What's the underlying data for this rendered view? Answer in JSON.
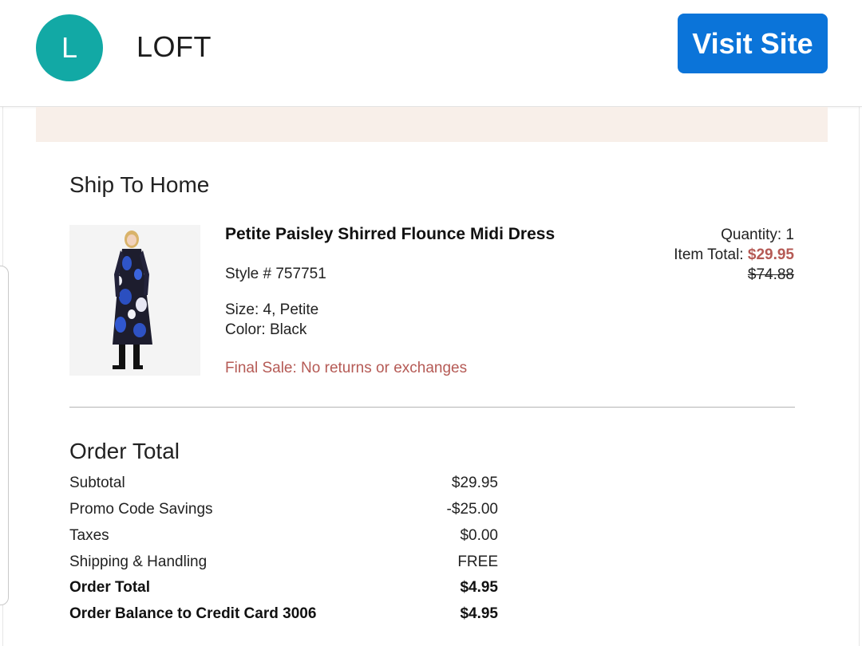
{
  "header": {
    "avatar_letter": "L",
    "brand_name": "LOFT",
    "visit_button_label": "Visit Site"
  },
  "colors": {
    "avatar_bg": "#12a9a5",
    "visit_button_bg": "#0b74d9",
    "banner_bg": "#f8efe9",
    "sale_red": "#b55a55"
  },
  "ship_section": {
    "title": "Ship To Home"
  },
  "product": {
    "image_icon": "product-photo",
    "name": "Petite Paisley Shirred Flounce Midi Dress",
    "style": "Style # 757751",
    "size": "Size: 4, Petite",
    "color": "Color: Black",
    "final_sale": "Final Sale: No returns or exchanges",
    "quantity": "Quantity: 1",
    "item_total_label": "Item Total: ",
    "item_total_price": "$29.95",
    "original_price": "$74.88"
  },
  "order_total": {
    "title": "Order Total",
    "rows": [
      {
        "label": "Subtotal",
        "value": "$29.95"
      },
      {
        "label": "Promo Code Savings",
        "value": "-$25.00"
      },
      {
        "label": "Taxes",
        "value": "$0.00"
      },
      {
        "label": "Shipping & Handling",
        "value": "FREE"
      },
      {
        "label": "Order Total",
        "value": "$4.95"
      },
      {
        "label": "Order Balance to Credit Card 3006",
        "value": "$4.95"
      }
    ]
  }
}
